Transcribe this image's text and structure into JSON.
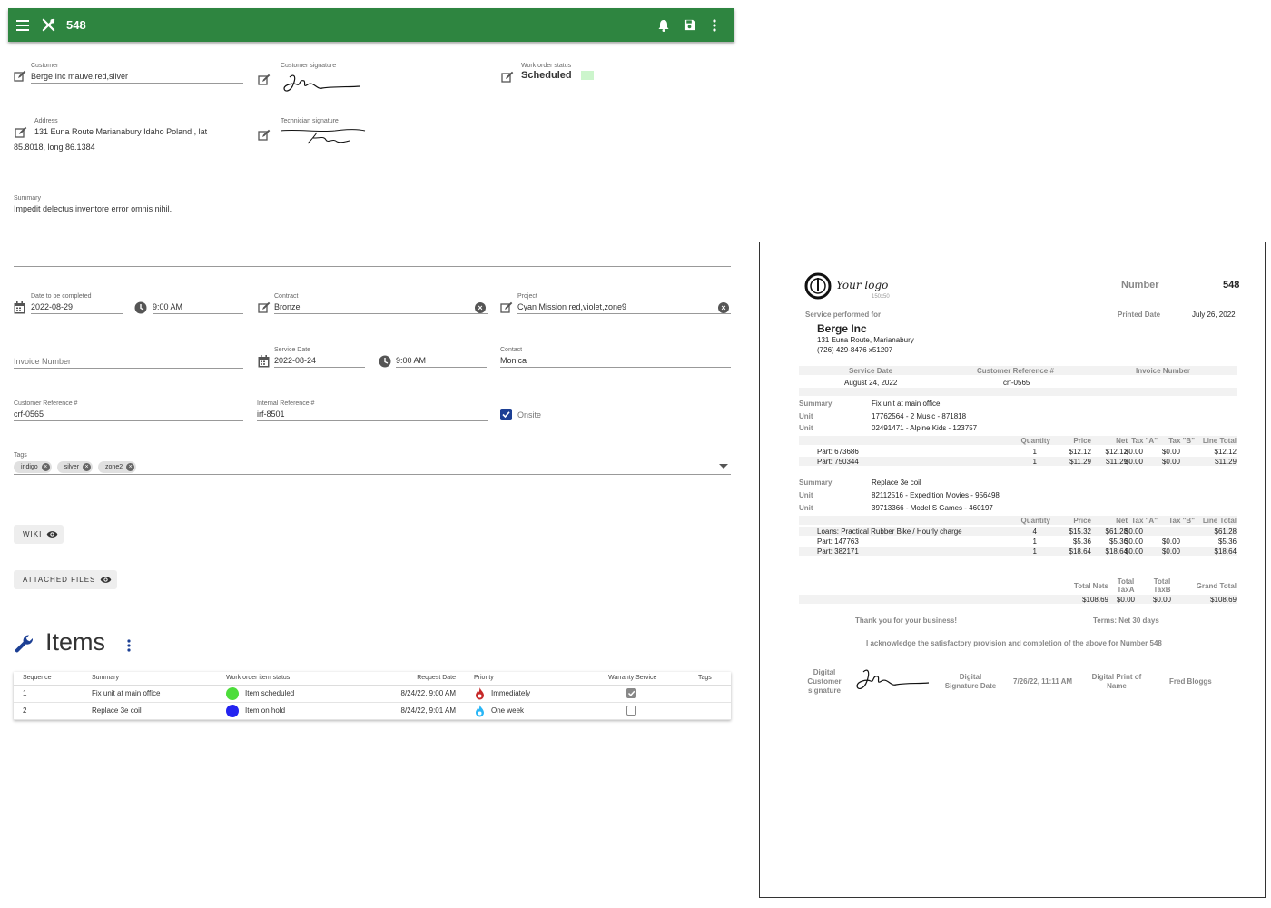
{
  "appbar": {
    "title": "548"
  },
  "form": {
    "customer": {
      "label": "Customer",
      "value": "Berge Inc mauve,red,silver"
    },
    "customer_signature": {
      "label": "Customer signature"
    },
    "status": {
      "label": "Work order status",
      "value": "Scheduled",
      "color": "#ccf5cc"
    },
    "address": {
      "label": "Address",
      "line1": "131 Euna Route Marianabury Idaho Poland , lat",
      "line2": "85.8018, long 86.1384"
    },
    "technician_signature": {
      "label": "Technician signature"
    },
    "summary": {
      "label": "Summary",
      "value": "Impedit delectus inventore error omnis nihil."
    },
    "date_to_complete": {
      "label": "Date to be completed",
      "value": "2022-08-29",
      "time": "9:00 AM"
    },
    "contract": {
      "label": "Contract",
      "value": "Bronze"
    },
    "project": {
      "label": "Project",
      "value": "Cyan Mission red,violet,zone9"
    },
    "invoice_number": {
      "placeholder": "Invoice Number"
    },
    "service_date": {
      "label": "Service Date",
      "value": "2022-08-24",
      "time": "9:00 AM"
    },
    "contact": {
      "label": "Contact",
      "value": "Monica"
    },
    "customer_ref": {
      "label": "Customer Reference #",
      "value": "crf-0565"
    },
    "internal_ref": {
      "label": "Internal Reference #",
      "value": "irf-8501"
    },
    "onsite": {
      "label": "Onsite",
      "checked": true
    },
    "tags": {
      "label": "Tags",
      "items": [
        "indigo",
        "silver",
        "zone2"
      ]
    },
    "wiki_button": "WIKI",
    "attached_files_button": "ATTACHED FILES"
  },
  "items": {
    "title": "Items",
    "columns": [
      "Sequence",
      "Summary",
      "Work order item status",
      "Request Date",
      "Priority",
      "Warranty Service",
      "Tags"
    ],
    "rows": [
      {
        "sequence": "1",
        "summary": "Fix unit at main office",
        "status": "Item scheduled",
        "status_color": "#4cdd3a",
        "request_date": "8/24/22, 9:00 AM",
        "priority": "Immediately",
        "priority_color": "#c62828",
        "warranty": true
      },
      {
        "sequence": "2",
        "summary": "Replace 3e coil",
        "status": "Item on hold",
        "status_color": "#2323f0",
        "request_date": "8/24/22, 9:01 AM",
        "priority": "One week",
        "priority_color": "#29b6f6",
        "warranty": false
      }
    ]
  },
  "report": {
    "logo_text": "Your logo",
    "logo_size": "150x50",
    "number_label": "Number",
    "number": "548",
    "service_performed_for": "Service performed for",
    "printed_date_label": "Printed Date",
    "printed_date": "July 26, 2022",
    "customer_name": "Berge Inc",
    "customer_address": "131 Euna Route, Marianabury",
    "customer_phone": "(726) 429-8476 x51207",
    "header_cols": [
      "Service Date",
      "Customer Reference #",
      "Invoice Number"
    ],
    "service_date": "August 24, 2022",
    "customer_ref": "crf-0565",
    "summary_label": "Summary",
    "unit_label": "Unit",
    "part_cols": [
      "Quantity",
      "Price",
      "Net",
      "Tax \"A\"",
      "Tax \"B\"",
      "Line Total"
    ],
    "groups": [
      {
        "summary": "Fix unit at main office",
        "units": [
          "17762564 - 2 Music - 871818",
          "02491471 - Alpine Kids - 123757"
        ],
        "lines": [
          {
            "desc": "Part: 673686",
            "qty": "1",
            "price": "$12.12",
            "net": "$12.12",
            "taxa": "$0.00",
            "taxb": "$0.00",
            "total": "$12.12"
          },
          {
            "desc": "Part: 750344",
            "qty": "1",
            "price": "$11.29",
            "net": "$11.29",
            "taxa": "$0.00",
            "taxb": "$0.00",
            "total": "$11.29"
          }
        ]
      },
      {
        "summary": "Replace 3e coil",
        "units": [
          "82112516 - Expedition Movies - 956498",
          "39713366 - Model S Games - 460197"
        ],
        "lines": [
          {
            "desc": "Loans: Practical Rubber Bike / Hourly charge",
            "qty": "4",
            "price": "$15.32",
            "net": "$61.28",
            "taxa": "$0.00",
            "taxb": "",
            "total": "$61.28"
          },
          {
            "desc": "Part: 147763",
            "qty": "1",
            "price": "$5.36",
            "net": "$5.36",
            "taxa": "$0.00",
            "taxb": "$0.00",
            "total": "$5.36"
          },
          {
            "desc": "Part: 382171",
            "qty": "1",
            "price": "$18.64",
            "net": "$18.64",
            "taxa": "$0.00",
            "taxb": "$0.00",
            "total": "$18.64"
          }
        ]
      }
    ],
    "totals": {
      "nets_label": "Total Nets",
      "taxa_label1": "Total",
      "taxa_label2": "TaxA",
      "taxb_label1": "Total",
      "taxb_label2": "TaxB",
      "grand_label": "Grand Total",
      "nets": "$108.69",
      "taxa": "$0.00",
      "taxb": "$0.00",
      "grand": "$108.69"
    },
    "thanks": "Thank you for your business!",
    "terms": "Terms: Net 30 days",
    "acknowledge": "I acknowledge the satisfactory provision and completion of the above for Number 548",
    "sig_label1": "Digital",
    "sig_label2": "Customer",
    "sig_label3": "signature",
    "sig_date_label1": "Digital",
    "sig_date_label2": "Signature Date",
    "sig_date": "7/26/22, 11:11 AM",
    "print_name_label1": "Digital Print of",
    "print_name_label2": "Name",
    "print_name": "Fred Bloggs"
  }
}
